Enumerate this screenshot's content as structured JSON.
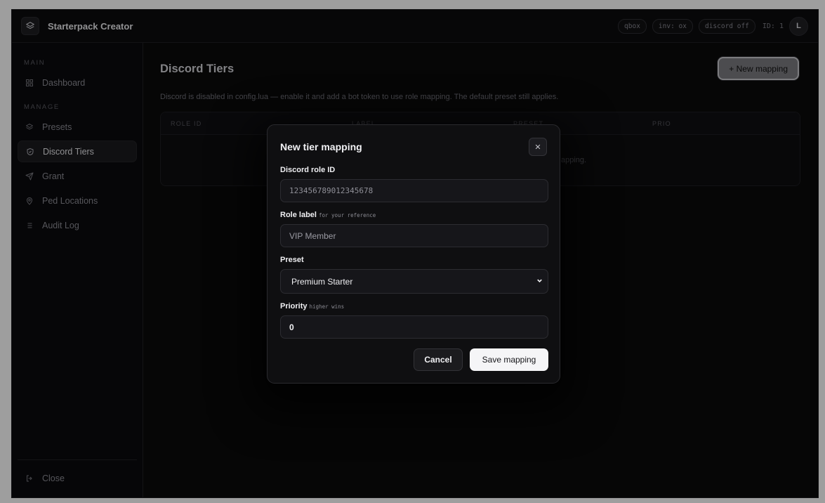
{
  "header": {
    "app_title": "Starterpack Creator",
    "pills": [
      "qbox",
      "inv: ox",
      "discord off"
    ],
    "user_id": "ID: 1",
    "avatar_initial": "L"
  },
  "sidebar": {
    "main_label": "MAIN",
    "manage_label": "MANAGE",
    "items": [
      {
        "label": "Dashboard",
        "icon": "grid-icon"
      },
      {
        "label": "Presets",
        "icon": "layers-icon"
      },
      {
        "label": "Discord Tiers",
        "icon": "shield-icon",
        "active": true
      },
      {
        "label": "Grant",
        "icon": "send-icon"
      },
      {
        "label": "Ped Locations",
        "icon": "map-pin-icon"
      },
      {
        "label": "Audit Log",
        "icon": "list-icon"
      }
    ],
    "close_label": "Close"
  },
  "main": {
    "title": "Discord Tiers",
    "new_button": "+ New mapping",
    "notice": "Discord is disabled in config.lua — enable it and add a bot token to use role mapping. The default preset still applies.",
    "columns": [
      "ROLE ID",
      "LABEL",
      "PRESET",
      "PRIO"
    ],
    "empty_text": "apping."
  },
  "modal": {
    "title": "New tier mapping",
    "role_id_label": "Discord role ID",
    "role_id_placeholder": "123456789012345678",
    "role_label_label": "Role label",
    "role_label_hint": "for your reference",
    "role_label_placeholder": "VIP Member",
    "preset_label": "Preset",
    "preset_value": "Premium Starter",
    "priority_label": "Priority",
    "priority_hint": "higher wins",
    "priority_value": "0",
    "cancel": "Cancel",
    "save": "Save mapping"
  }
}
